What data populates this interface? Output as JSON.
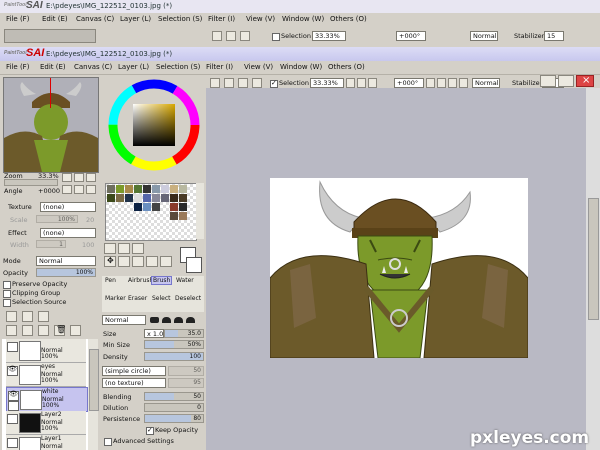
{
  "back_window": {
    "app_name": "SAI",
    "logo_small": "PaintTool",
    "title": "E:\\pdeyes\\IMG_122512_0103.jpg (*)",
    "menu": [
      "File (F)",
      "Edit (E)",
      "Canvas (C)",
      "Layer (L)",
      "Selection (S)",
      "Filter (I)",
      "View (V)",
      "Window (W)",
      "Others (O)"
    ],
    "toolbar": {
      "selection_label": "Selection",
      "zoom": "33.33%",
      "rotation": "+000°",
      "blend": "Normal",
      "stabilizer_label": "Stabilizer",
      "stabilizer_value": "15"
    }
  },
  "front_window": {
    "app_name": "SAI",
    "logo_small": "PaintTool",
    "title": "E:\\pdeyes\\IMG_122512_0103.jpg (*)",
    "menu": [
      "File (F)",
      "Edit (E)",
      "Canvas (C)",
      "Layer (L)",
      "Selection (S)",
      "Filter (I)",
      "View (V)",
      "Window (W)",
      "Others (O)"
    ],
    "toolbar": {
      "selection_label": "Selection",
      "zoom": "33.33%",
      "rotation": "+000°",
      "blend": "Normal",
      "stabilizer_label": "Stabilizer",
      "stabilizer_value": "15"
    }
  },
  "navigator": {
    "zoom_label": "Zoom",
    "zoom_value": "33.3%",
    "angle_label": "Angle",
    "angle_value": "+0000"
  },
  "layer_props": {
    "texture_label": "Texture",
    "texture_value": "(none)",
    "scale_label": "Scale",
    "scale_value": "100%",
    "scale_num": "20",
    "effect_label": "Effect",
    "effect_value": "(none)",
    "width_label": "Width",
    "width_value": "1",
    "width_num": "100",
    "mode_label": "Mode",
    "mode_value": "Normal",
    "opacity_label": "Opacity",
    "opacity_value": "100%",
    "opacity_fraction": 1.0,
    "preserve_opacity": "Preserve Opacity",
    "clipping_group": "Clipping Group",
    "selection_source": "Selection Source"
  },
  "layers": [
    {
      "name": "",
      "mode": "Normal",
      "opacity": "100%",
      "selected": false
    },
    {
      "name": "eyes",
      "mode": "Normal",
      "opacity": "100%",
      "selected": false
    },
    {
      "name": "white",
      "mode": "Normal",
      "opacity": "100%",
      "selected": true
    },
    {
      "name": "Layer2",
      "mode": "Normal",
      "opacity": "100%",
      "selected": false
    },
    {
      "name": "Layer1",
      "mode": "Normal",
      "opacity": "",
      "selected": false
    }
  ],
  "tools": {
    "row1": [
      "Pen",
      "Airbrush",
      "Brush",
      "Water"
    ],
    "row2": [
      "Marker",
      "Eraser",
      "Select",
      "Deselect"
    ]
  },
  "brush": {
    "mode_value": "Normal",
    "size_label": "Size",
    "size_mult": "x 1.0",
    "size_value": "35.0",
    "size_fraction": 0.35,
    "min_size_label": "Min Size",
    "min_size_value": "50%",
    "min_size_fraction": 0.5,
    "density_label": "Density",
    "density_value": "100",
    "density_fraction": 1.0,
    "shape_value": "(simple circle)",
    "shape_num": "50",
    "texture_value": "(no texture)",
    "texture_num": "95",
    "blending_label": "Blending",
    "blending_value": "50",
    "blending_fraction": 0.5,
    "dilution_label": "Dilution",
    "dilution_value": "0",
    "dilution_fraction": 0.0,
    "persistence_label": "Persistence",
    "persistence_value": "80",
    "persistence_fraction": 0.8,
    "keep_opacity": "Keep Opacity",
    "advanced": "Advanced Settings"
  },
  "watermark": "pxleyes.com",
  "colors": {
    "titlebar": "#c8c8ee",
    "panel": "#d4d0c8",
    "accent_red": "#cc0000",
    "skin": "#7c9a2a"
  }
}
